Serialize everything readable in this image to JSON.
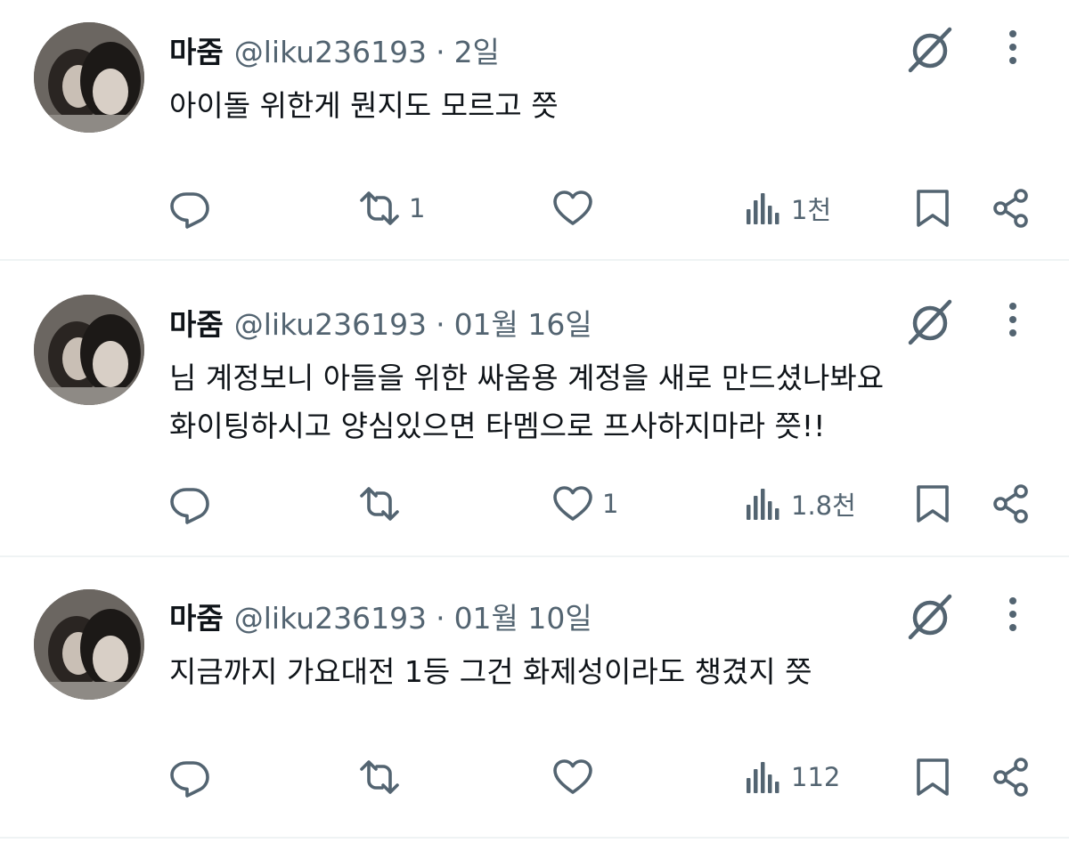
{
  "tweets": [
    {
      "name": "마줌",
      "handle": "@liku236193",
      "separator": "·",
      "time": "2일",
      "text_lines": [
        "아이돌 위한게 뭔지도 모르고 쯧"
      ],
      "reply_count": "",
      "retweet_count": "1",
      "like_count": "",
      "view_count": "1천"
    },
    {
      "name": "마줌",
      "handle": "@liku236193",
      "separator": "·",
      "time": "01월 16일",
      "text_lines": [
        "님 계정보니 아들을 위한 싸움용 계정을 새로 만드셨나봐요",
        "화이팅하시고 양심있으면 타멤으로 프사하지마라 쯧!!"
      ],
      "reply_count": "",
      "retweet_count": "",
      "like_count": "1",
      "view_count": "1.8천"
    },
    {
      "name": "마줌",
      "handle": "@liku236193",
      "separator": "·",
      "time": "01월 10일",
      "text_lines": [
        "지금까지 가요대전 1등 그건 화제성이라도 챙겼지 쯧"
      ],
      "reply_count": "",
      "retweet_count": "",
      "like_count": "",
      "view_count": "112"
    }
  ],
  "icons": {
    "reply": "reply-icon",
    "retweet": "retweet-icon",
    "like": "heart-icon",
    "views": "views-icon",
    "bookmark": "bookmark-icon",
    "share": "share-icon",
    "grok": "grok-icon",
    "more": "more-icon"
  },
  "colors": {
    "text": "#0f1419",
    "secondary": "#536471",
    "divider": "#eff3f4"
  }
}
